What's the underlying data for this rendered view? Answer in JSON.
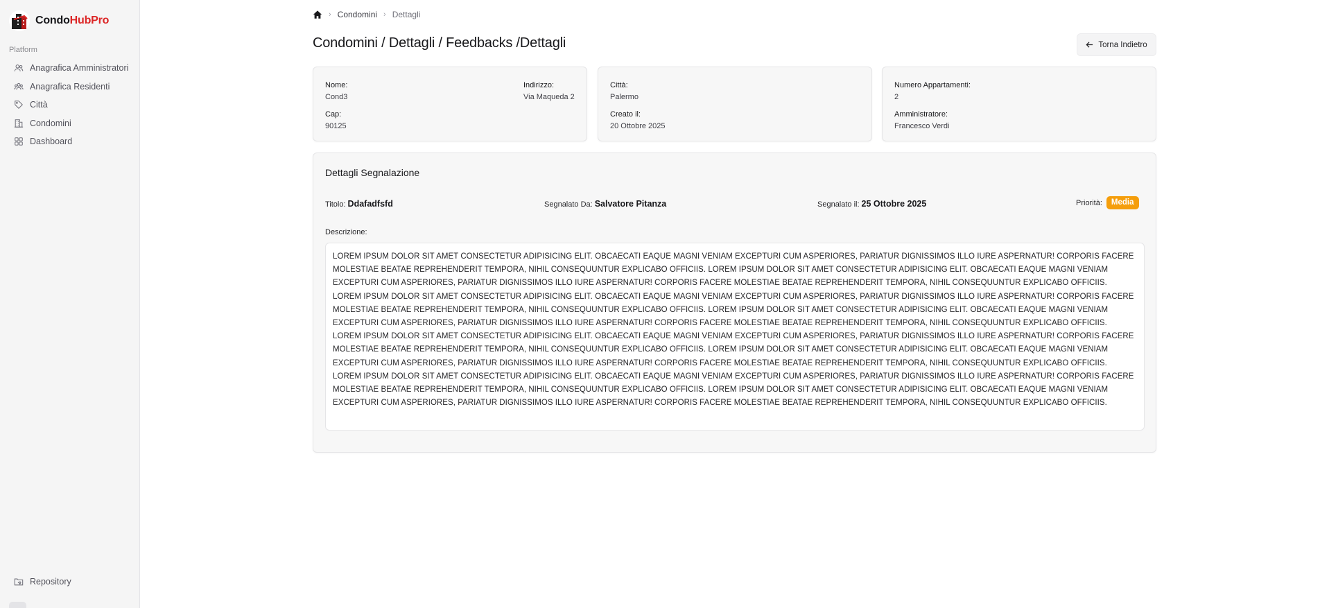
{
  "brand": {
    "name_part1": "Condo",
    "name_part2": "HubPro"
  },
  "sidebar": {
    "group_label": "Platform",
    "items": [
      {
        "label": "Anagrafica Amministratori",
        "icon": "users-icon"
      },
      {
        "label": "Anagrafica Residenti",
        "icon": "users-group-icon"
      },
      {
        "label": "Città",
        "icon": "tag-icon"
      },
      {
        "label": "Condomini",
        "icon": "building-icon"
      },
      {
        "label": "Dashboard",
        "icon": "grid-icon"
      }
    ],
    "bottom_item": {
      "label": "Repository",
      "icon": "folder-git-icon"
    }
  },
  "breadcrumb": {
    "level1": "Condomini",
    "level2": "Dettagli"
  },
  "page_title": "Condomini / Dettagli / Feedbacks /Dettagli",
  "back_button": {
    "label": "Torna Indietro"
  },
  "condo_info": {
    "nome": {
      "label": "Nome:",
      "value": "Cond3"
    },
    "indirizzo": {
      "label": "Indirizzo:",
      "value": "Via Maqueda 2"
    },
    "cap": {
      "label": "Cap:",
      "value": "90125"
    },
    "citta": {
      "label": "Città:",
      "value": "Palermo"
    },
    "creato_il": {
      "label": "Creato il:",
      "value": "20 Ottobre 2025"
    },
    "numero_appartamenti": {
      "label": "Numero Appartamenti:",
      "value": "2"
    },
    "amministratore": {
      "label": "Amministratore:",
      "value": "Francesco Verdi"
    }
  },
  "report": {
    "section_title": "Dettagli Segnalazione",
    "titolo": {
      "label": "Titolo:",
      "value": "Ddafadfsfd"
    },
    "segnalato_da": {
      "label": "Segnalato Da:",
      "value": "Salvatore Pitanza"
    },
    "segnalato_il": {
      "label": "Segnalato il:",
      "value": "25 Ottobre 2025"
    },
    "priorita": {
      "label": "Priorità:",
      "value": "Media",
      "color": "#f59e0b"
    },
    "descrizione_label": "Descrizione:",
    "descrizione": "Lorem ipsum dolor sit amet consectetur adipisicing elit. Obcaecati eaque magni veniam excepturi cum asperiores, pariatur dignissimos illo iure aspernatur! Corporis facere molestiae beatae reprehenderit tempora, nihil consequuntur explicabo officiis. Lorem ipsum dolor sit amet consectetur adipisicing elit. Obcaecati eaque magni veniam excepturi cum asperiores, pariatur dignissimos illo iure aspernatur! Corporis facere molestiae beatae reprehenderit tempora, nihil consequuntur explicabo officiis. Lorem ipsum dolor sit amet consectetur adipisicing elit. Obcaecati eaque magni veniam excepturi cum asperiores, pariatur dignissimos illo iure aspernatur! Corporis facere molestiae beatae reprehenderit tempora, nihil consequuntur explicabo officiis. Lorem ipsum dolor sit amet consectetur adipisicing elit. Obcaecati eaque magni veniam excepturi cum asperiores, pariatur dignissimos illo iure aspernatur! Corporis facere molestiae beatae reprehenderit tempora, nihil consequuntur explicabo officiis. Lorem ipsum dolor sit amet consectetur adipisicing elit. Obcaecati eaque magni veniam excepturi cum asperiores, pariatur dignissimos illo iure aspernatur! Corporis facere molestiae beatae reprehenderit tempora, nihil consequuntur explicabo officiis. Lorem ipsum dolor sit amet consectetur adipisicing elit. Obcaecati eaque magni veniam excepturi cum asperiores, pariatur dignissimos illo iure aspernatur! Corporis facere molestiae beatae reprehenderit tempora, nihil consequuntur explicabo officiis. Lorem ipsum dolor sit amet consectetur adipisicing elit. Obcaecati eaque magni veniam excepturi cum asperiores, pariatur dignissimos illo iure aspernatur! Corporis facere molestiae beatae reprehenderit tempora, nihil consequuntur explicabo officiis. Lorem ipsum dolor sit amet consectetur adipisicing elit. Obcaecati eaque magni veniam excepturi cum asperiores, pariatur dignissimos illo iure aspernatur! Corporis facere molestiae beatae reprehenderit tempora, nihil consequuntur explicabo officiis."
  },
  "colors": {
    "brand_red": "#dc2626",
    "priority_media": "#f59e0b",
    "sidebar_bg": "#f5f5f5"
  }
}
